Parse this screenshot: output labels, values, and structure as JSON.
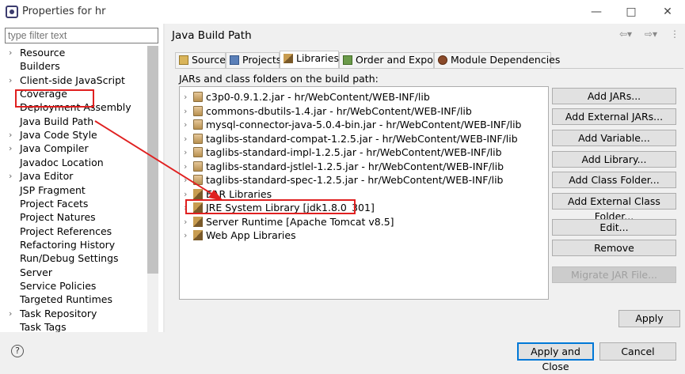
{
  "window": {
    "title": "Properties for hr",
    "min_label": "—",
    "max_label": "□",
    "close_label": "✕"
  },
  "sidebar": {
    "filter_placeholder": "type filter text",
    "items": [
      {
        "label": "Resource",
        "expandable": true
      },
      {
        "label": "Builders",
        "expandable": false
      },
      {
        "label": "Client-side JavaScript",
        "expandable": true
      },
      {
        "label": "Coverage",
        "expandable": false
      },
      {
        "label": "Deployment Assembly",
        "expandable": false
      },
      {
        "label": "Java Build Path",
        "expandable": false
      },
      {
        "label": "Java Code Style",
        "expandable": true
      },
      {
        "label": "Java Compiler",
        "expandable": true
      },
      {
        "label": "Javadoc Location",
        "expandable": false
      },
      {
        "label": "Java Editor",
        "expandable": true
      },
      {
        "label": "JSP Fragment",
        "expandable": false
      },
      {
        "label": "Project Facets",
        "expandable": false
      },
      {
        "label": "Project Natures",
        "expandable": false
      },
      {
        "label": "Project References",
        "expandable": false
      },
      {
        "label": "Refactoring History",
        "expandable": false
      },
      {
        "label": "Run/Debug Settings",
        "expandable": false
      },
      {
        "label": "Server",
        "expandable": false
      },
      {
        "label": "Service Policies",
        "expandable": false
      },
      {
        "label": "Targeted Runtimes",
        "expandable": false
      },
      {
        "label": "Task Repository",
        "expandable": true
      },
      {
        "label": "Task Tags",
        "expandable": false
      }
    ]
  },
  "main": {
    "title": "Java Build Path",
    "tabs": [
      {
        "label": "Source",
        "icon": "source-folder-icon"
      },
      {
        "label": "Projects",
        "icon": "projects-icon"
      },
      {
        "label": "Libraries",
        "icon": "libraries-icon",
        "active": true
      },
      {
        "label": "Order and Export",
        "icon": "order-export-icon"
      },
      {
        "label": "Module Dependencies",
        "icon": "module-icon"
      }
    ],
    "list_label": "JARs and class folders on the build path:",
    "entries": [
      {
        "label": "c3p0-0.9.1.2.jar - hr/WebContent/WEB-INF/lib",
        "icon": "jar-icon"
      },
      {
        "label": "commons-dbutils-1.4.jar - hr/WebContent/WEB-INF/lib",
        "icon": "jar-icon"
      },
      {
        "label": "mysql-connector-java-5.0.4-bin.jar - hr/WebContent/WEB-INF/lib",
        "icon": "jar-icon"
      },
      {
        "label": "taglibs-standard-compat-1.2.5.jar - hr/WebContent/WEB-INF/lib",
        "icon": "jar-icon"
      },
      {
        "label": "taglibs-standard-impl-1.2.5.jar - hr/WebContent/WEB-INF/lib",
        "icon": "jar-icon"
      },
      {
        "label": "taglibs-standard-jstlel-1.2.5.jar - hr/WebContent/WEB-INF/lib",
        "icon": "jar-icon"
      },
      {
        "label": "taglibs-standard-spec-1.2.5.jar - hr/WebContent/WEB-INF/lib",
        "icon": "jar-icon"
      },
      {
        "label": "EAR Libraries",
        "icon": "library-icon"
      },
      {
        "label": "JRE System Library [jdk1.8.0_301]",
        "icon": "library-icon"
      },
      {
        "label": "Server Runtime [Apache Tomcat v8.5]",
        "icon": "library-icon"
      },
      {
        "label": "Web App Libraries",
        "icon": "library-icon"
      }
    ],
    "buttons": {
      "add_jars": "Add JARs...",
      "add_external_jars": "Add External JARs...",
      "add_variable": "Add Variable...",
      "add_library": "Add Library...",
      "add_class_folder": "Add Class Folder...",
      "add_external_class_folder": "Add External Class Folder...",
      "edit": "Edit...",
      "remove": "Remove",
      "migrate_jar": "Migrate JAR File...",
      "apply": "Apply"
    }
  },
  "footer": {
    "help": "?",
    "apply_close": "Apply and Close",
    "cancel": "Cancel"
  },
  "colors": {
    "annotation": "#e02020",
    "primary_border": "#0078d7"
  }
}
